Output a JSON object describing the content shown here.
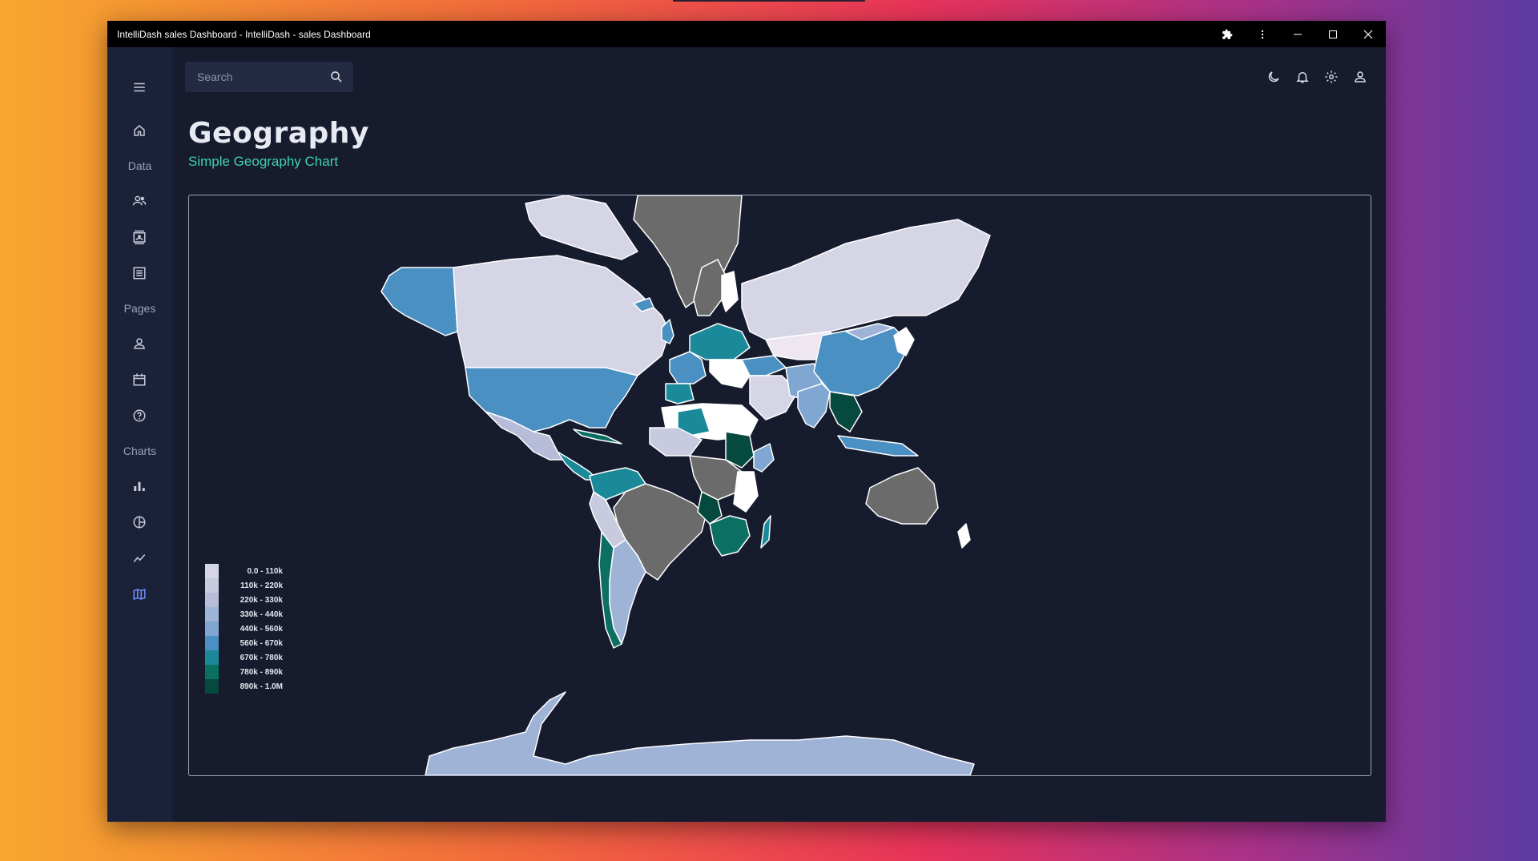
{
  "window": {
    "title": "IntelliDash sales Dashboard - IntelliDash - sales Dashboard"
  },
  "titlebar_icons": [
    "puzzle-icon",
    "more-vert-icon",
    "minimize-icon",
    "maximize-icon",
    "close-icon"
  ],
  "sidebar": {
    "sections": [
      {
        "label": "Data",
        "items": [
          "people-icon",
          "contacts-icon",
          "list-icon"
        ]
      },
      {
        "label": "Pages",
        "items": [
          "person-icon",
          "calendar-icon",
          "help-icon"
        ]
      },
      {
        "label": "Charts",
        "items": [
          "bar-chart-icon",
          "pie-chart-icon",
          "line-chart-icon",
          "map-icon"
        ]
      }
    ],
    "active": "map-icon",
    "accent": "#6f8cff"
  },
  "search": {
    "placeholder": "Search"
  },
  "header_icons": [
    "dark-mode-icon",
    "notifications-icon",
    "settings-icon",
    "account-icon"
  ],
  "page": {
    "title": "Geography",
    "subtitle": "Simple Geography Chart",
    "subtitle_color": "#3fd1b2"
  },
  "chart_data": {
    "type": "choropleth",
    "legend": [
      {
        "label": "0.0 - 110k",
        "color": "#d6d5e6"
      },
      {
        "label": "110k - 220k",
        "color": "#c8cadf"
      },
      {
        "label": "220k - 330k",
        "color": "#b7bdd8"
      },
      {
        "label": "330k - 440k",
        "color": "#9fb3d6"
      },
      {
        "label": "440k - 560k",
        "color": "#7fa7d2"
      },
      {
        "label": "560k - 670k",
        "color": "#4a90c2"
      },
      {
        "label": "670k - 780k",
        "color": "#1a8a9a"
      },
      {
        "label": "780k - 890k",
        "color": "#0b6f64"
      },
      {
        "label": "890k - 1.0M",
        "color": "#06493e"
      }
    ],
    "no_data_color": "#6b6b6b",
    "legend_position": "bottom-left"
  }
}
